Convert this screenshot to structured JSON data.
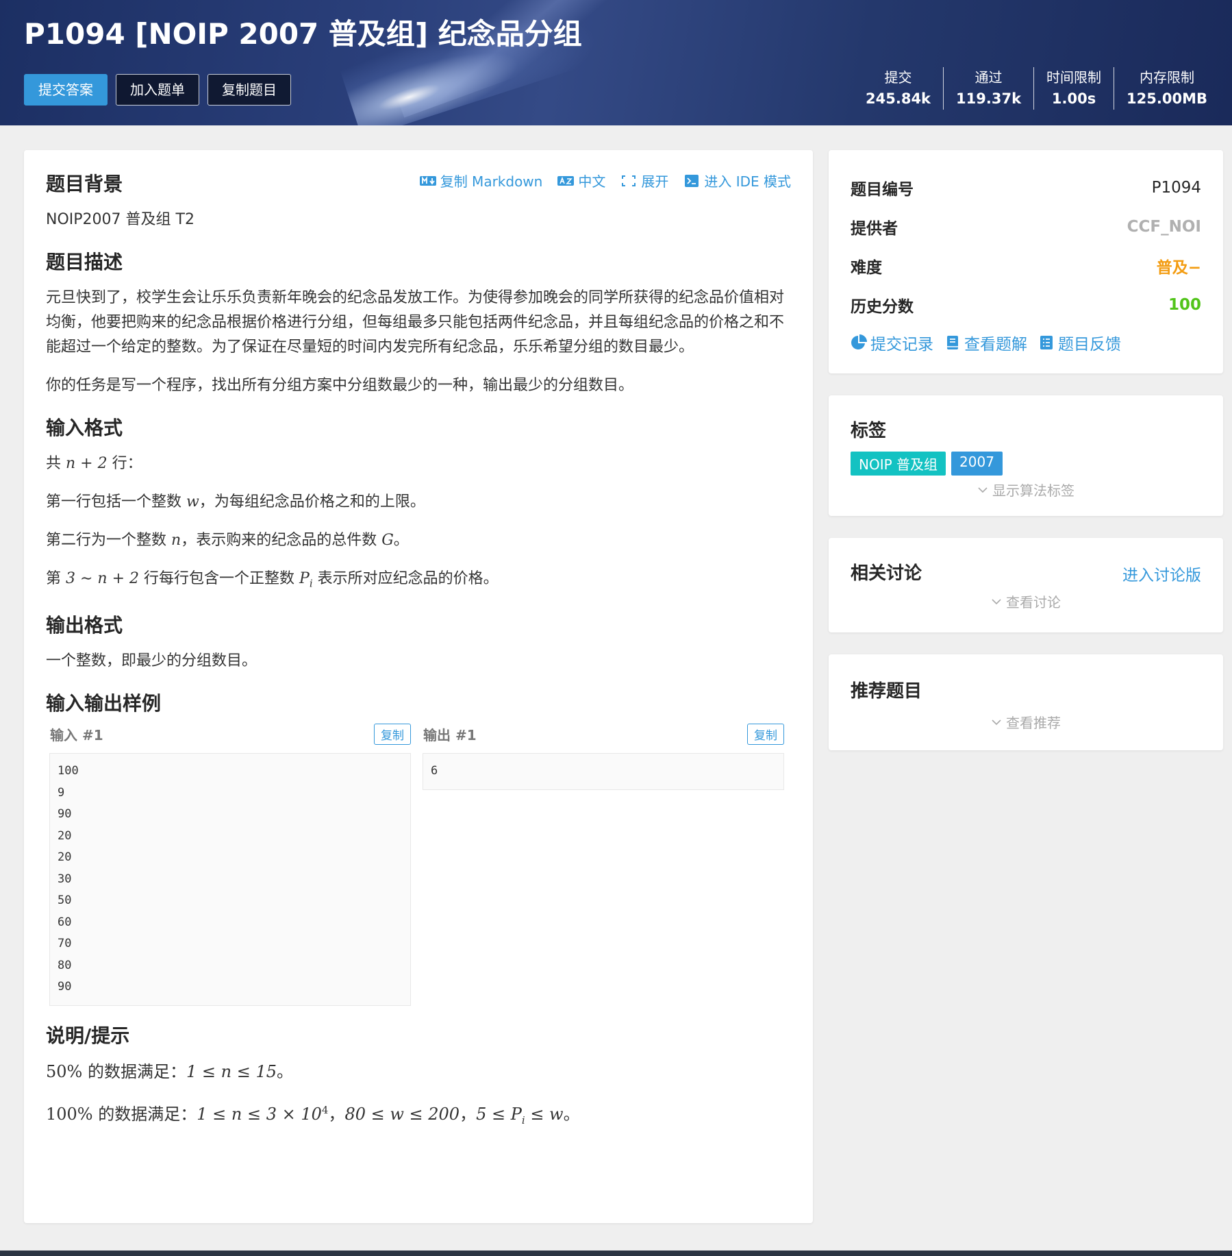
{
  "header": {
    "title": "P1094 [NOIP 2007 普及组] 纪念品分组",
    "buttons": {
      "submit": "提交答案",
      "add_to_list": "加入题单",
      "copy_problem": "复制题目"
    },
    "stats": [
      {
        "label": "提交",
        "value": "245.84k"
      },
      {
        "label": "通过",
        "value": "119.37k"
      },
      {
        "label": "时间限制",
        "value": "1.00s"
      },
      {
        "label": "内存限制",
        "value": "125.00MB"
      }
    ]
  },
  "toolbar": {
    "copy_markdown": "复制 Markdown",
    "language": "中文",
    "expand": "展开",
    "ide_mode": "进入 IDE 模式"
  },
  "problem": {
    "background_title": "题目背景",
    "background_text": "NOIP2007 普及组 T2",
    "description_title": "题目描述",
    "description_p1": "元旦快到了，校学生会让乐乐负责新年晚会的纪念品发放工作。为使得参加晚会的同学所获得的纪念品价值相对均衡，他要把购来的纪念品根据价格进行分组，但每组最多只能包括两件纪念品，并且每组纪念品的价格之和不能超过一个给定的整数。为了保证在尽量短的时间内发完所有纪念品，乐乐希望分组的数目最少。",
    "description_p2": "你的任务是写一个程序，找出所有分组方案中分组数最少的一种，输出最少的分组数目。",
    "input_title": "输入格式",
    "input_l1_a": "共",
    "input_l1_math": "n + 2",
    "input_l1_b": "行：",
    "input_l2_a": "第一行包括一个整数",
    "input_l2_math": "w",
    "input_l2_b": "，为每组纪念品价格之和的上限。",
    "input_l3_a": "第二行为一个整数",
    "input_l3_math1": "n",
    "input_l3_b": "，表示购来的纪念品的总件数",
    "input_l3_math2": "G",
    "input_l3_c": "。",
    "input_l4_a": "第",
    "input_l4_math1": "3 ∼ n + 2",
    "input_l4_b": "行每行包含一个正整数",
    "input_l4_math2": "P",
    "input_l4_sub": "i",
    "input_l4_c": "表示所对应纪念品的价格。",
    "output_title": "输出格式",
    "output_text": "一个整数，即最少的分组数目。",
    "samples_title": "输入输出样例",
    "sample_input_label": "输入 #1",
    "sample_output_label": "输出 #1",
    "copy_label": "复制",
    "sample_input": "100\n9\n90\n20\n20\n30\n50\n60\n70\n80\n90",
    "sample_output": "6",
    "hint_title": "说明/提示",
    "hint1_math1": "50%",
    "hint1_a": "的数据满足：",
    "hint1_math2": "1 ≤ n ≤ 15",
    "hint1_b": "。",
    "hint2_math1": "100%",
    "hint2_a": "的数据满足：",
    "hint2_math2": "1 ≤ n ≤ 3 × 10",
    "hint2_sup": "4",
    "hint2_b": "，",
    "hint2_math3": "80 ≤ w ≤ 200",
    "hint2_c": "，",
    "hint2_math4": "5 ≤ P",
    "hint2_sub": "i",
    "hint2_math5": " ≤ w",
    "hint2_d": "。"
  },
  "info": {
    "id_label": "题目编号",
    "id_value": "P1094",
    "provider_label": "提供者",
    "provider_value": "CCF_NOI",
    "difficulty_label": "难度",
    "difficulty_value": "普及−",
    "score_label": "历史分数",
    "score_value": "100",
    "links": {
      "records": "提交记录",
      "solutions": "查看题解",
      "feedback": "题目反馈"
    }
  },
  "tags_card": {
    "title": "标签",
    "tags": [
      "NOIP 普及组",
      "2007"
    ],
    "show_algo": "显示算法标签"
  },
  "discuss_card": {
    "title": "相关讨论",
    "enter": "进入讨论版",
    "view": "查看讨论"
  },
  "recommend_card": {
    "title": "推荐题目",
    "view": "查看推荐"
  },
  "colors": {
    "accent": "#3498db",
    "difficulty": "#f39c11",
    "score": "#52c41a",
    "tag_teal": "#13c2c2"
  }
}
